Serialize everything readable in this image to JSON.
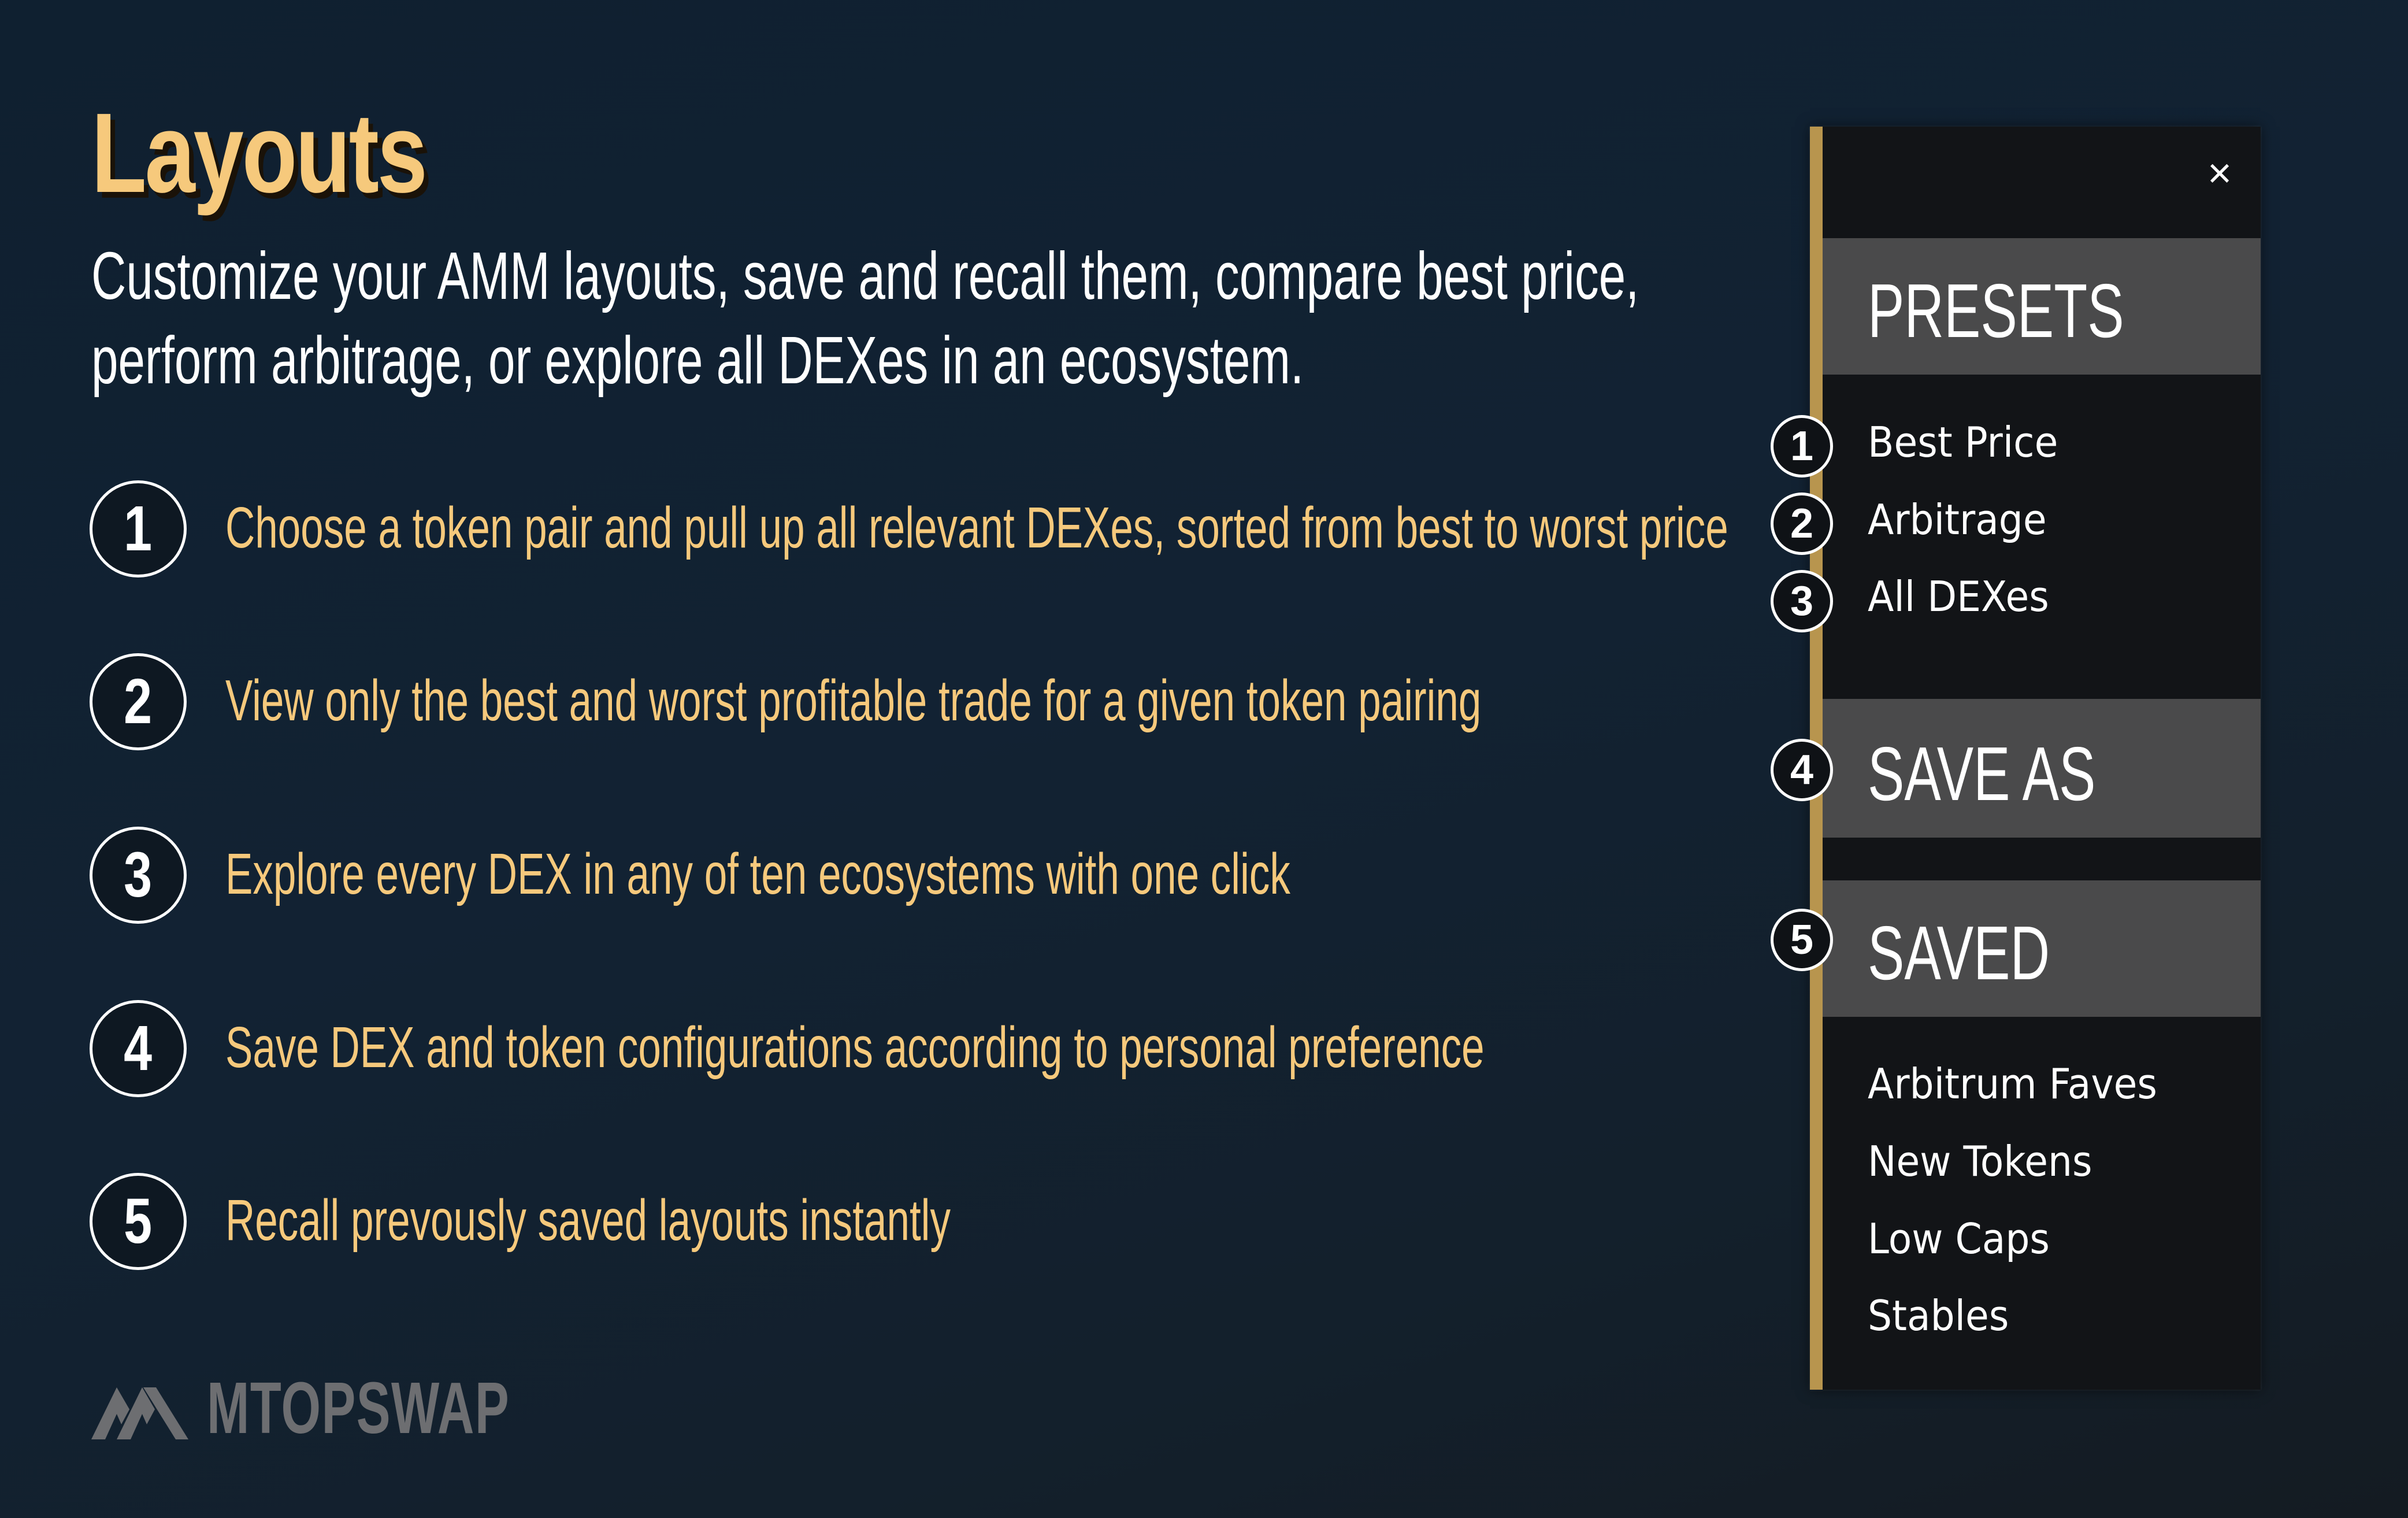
{
  "heading": {
    "title": "Layouts",
    "subtitle_line1": "Customize your AMM layouts, save and recall them, compare best price,",
    "subtitle_line2": "perform arbitrage, or explore all DEXes in an ecosystem."
  },
  "features": [
    {
      "number": "1",
      "text": "Choose a token pair and pull up all relevant DEXes, sorted from best to worst price"
    },
    {
      "number": "2",
      "text": "View only the best and worst profitable trade for a given token pairing"
    },
    {
      "number": "3",
      "text": "Explore every DEX in any of ten ecosystems with one click"
    },
    {
      "number": "4",
      "text": "Save DEX and token configurations according to personal preference"
    },
    {
      "number": "5",
      "text": "Recall prevously saved layouts instantly"
    }
  ],
  "logo": {
    "text": "MTOPSWAP",
    "icon": "mtopswap-logo-icon"
  },
  "panel": {
    "close_label": "×",
    "presets": {
      "title": "PRESETS",
      "items": [
        "Best Price",
        "Arbitrage",
        "All DEXes"
      ]
    },
    "save_as": {
      "title": "SAVE AS"
    },
    "saved": {
      "title": "SAVED",
      "items": [
        "Arbitrum Faves",
        "New Tokens",
        "Low Caps",
        "Stables"
      ]
    },
    "badges": [
      "1",
      "2",
      "3",
      "4",
      "5"
    ]
  },
  "colors": {
    "accent_gold": "#f6c97c",
    "panel_bar": "#b8954e",
    "section_header": "#4a4a4b",
    "panel_bg": "#121417"
  }
}
